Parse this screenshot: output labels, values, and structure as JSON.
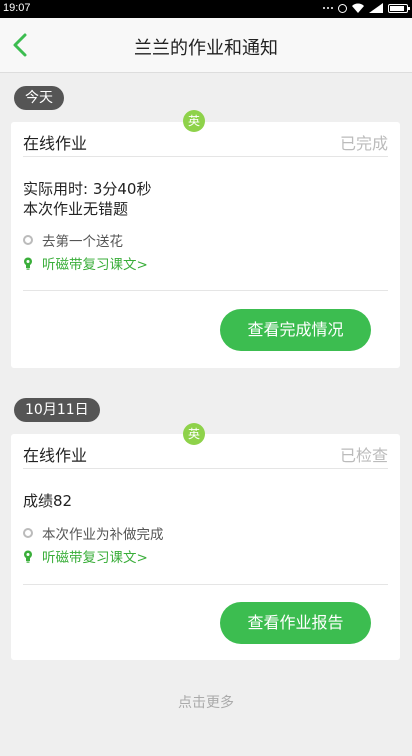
{
  "status_bar": {
    "time": "19:07"
  },
  "header": {
    "title": "兰兰的作业和通知"
  },
  "groups": [
    {
      "date": "今天",
      "card": {
        "subject": "英",
        "title": "在线作业",
        "status": "已完成",
        "lines": [
          "实际用时: 3分40秒",
          "本次作业无错题"
        ],
        "note": "去第一个送花",
        "tip": "听磁带复习课文>",
        "button": "查看完成情况"
      }
    },
    {
      "date": "10月11日",
      "card": {
        "subject": "英",
        "title": "在线作业",
        "status": "已检查",
        "lines": [
          "成绩82"
        ],
        "note": "本次作业为补做完成",
        "tip": "听磁带复习课文>",
        "button": "查看作业报告"
      }
    }
  ],
  "footer": {
    "more_label": "点击更多"
  },
  "colors": {
    "accent_green": "#3cbd50",
    "subject_badge": "#8ed24a",
    "tip_text": "#3aae3a"
  }
}
